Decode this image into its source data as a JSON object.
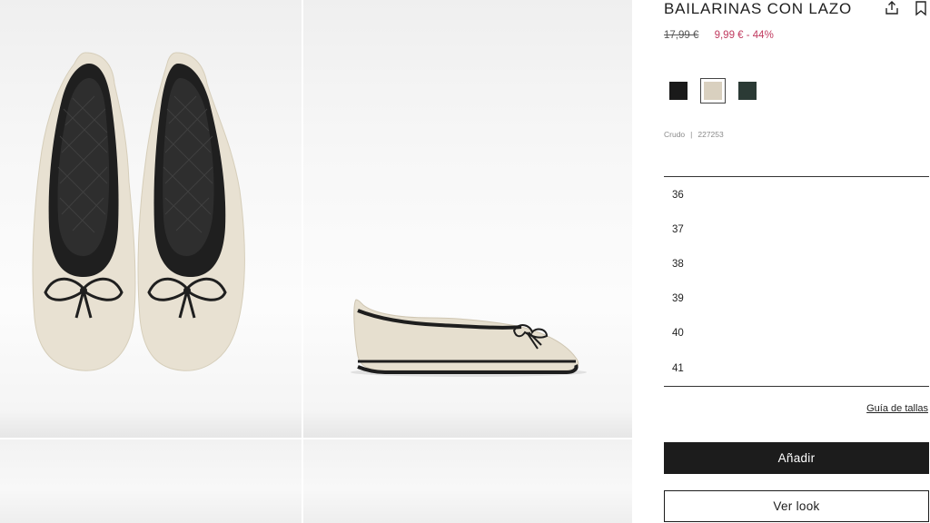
{
  "product": {
    "title": "BAILARINAS CON LAZO",
    "old_price": "17,99 €",
    "price_discount": "9,99 € - 44%",
    "color_name": "Crudo",
    "meta_separator": "|",
    "reference": "227253"
  },
  "swatches": [
    {
      "name": "black",
      "color": "#1a1a1a"
    },
    {
      "name": "cream",
      "color": "#d9d0bf",
      "selected": true
    },
    {
      "name": "dark-green",
      "color": "#2b3a35"
    }
  ],
  "sizes": [
    "36",
    "37",
    "38",
    "39",
    "40",
    "41"
  ],
  "links": {
    "size_guide": "Guía de tallas"
  },
  "buttons": {
    "add": "Añadir",
    "view_look": "Ver look"
  },
  "icons": {
    "share": "share-icon",
    "bookmark": "bookmark-icon"
  },
  "colors": {
    "accent_price": "#c03a5f",
    "primary_button": "#1c1c1c",
    "shoe_body": "#e8e1d2",
    "shoe_trim": "#1e1e1e"
  }
}
